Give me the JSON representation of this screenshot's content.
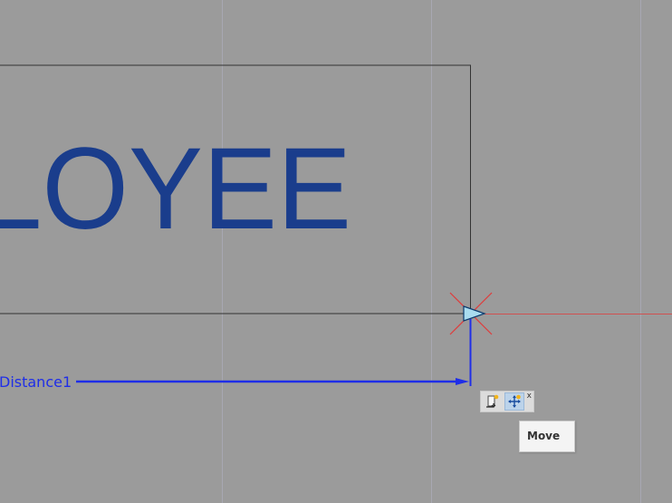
{
  "drawing": {
    "label_text": "LOYEE",
    "dimension_label": "Distance1",
    "colors": {
      "background": "#9b9b9b",
      "text": "#1a3d8c",
      "dimension": "#1f2ee8",
      "frame": "#333333",
      "grid": "#a6a6ad",
      "axis_red": "#e04040"
    }
  },
  "mini_toolbar": {
    "buttons": [
      {
        "icon": "insert-icon"
      },
      {
        "icon": "move-icon"
      }
    ],
    "close_label": "x"
  },
  "tooltip": {
    "text": "Move"
  }
}
